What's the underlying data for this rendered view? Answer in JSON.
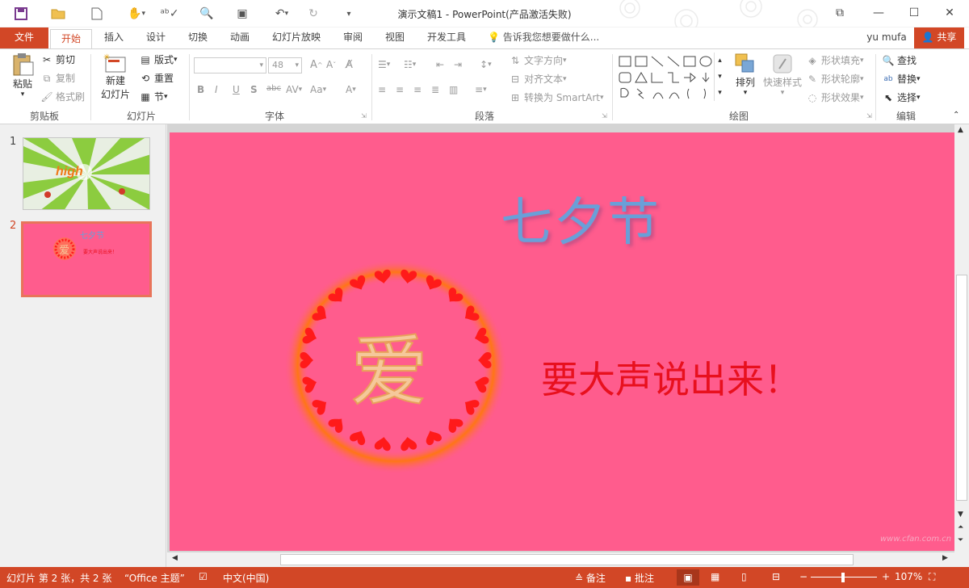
{
  "window": {
    "title": "演示文稿1 - PowerPoint(产品激活失败)",
    "accent": "#d24726"
  },
  "quick_access": [
    "save-icon",
    "open-icon",
    "new-icon",
    "touch-mode-icon",
    "spelling-icon",
    "print-preview-icon",
    "present-icon",
    "undo-icon",
    "redo-icon",
    "customize-icon"
  ],
  "menu": {
    "file": "文件",
    "tabs": [
      "开始",
      "插入",
      "设计",
      "切换",
      "动画",
      "幻灯片放映",
      "审阅",
      "视图",
      "开发工具"
    ],
    "tell_me": "告诉我您想要做什么...",
    "user": "yu mufa",
    "share": "共享"
  },
  "ribbon": {
    "clipboard": {
      "paste": "粘贴",
      "cut": "剪切",
      "copy": "复制",
      "format_painter": "格式刷",
      "label": "剪贴板"
    },
    "slides": {
      "new_slide_1": "新建",
      "new_slide_2": "幻灯片",
      "layout": "版式",
      "reset": "重置",
      "section": "节",
      "label": "幻灯片"
    },
    "font": {
      "size": "48",
      "label": "字体"
    },
    "paragraph": {
      "text_direction": "文字方向",
      "align_text": "对齐文本",
      "convert_smartart": "转换为 SmartArt",
      "label": "段落"
    },
    "drawing": {
      "arrange": "排列",
      "quick_styles": "快速样式",
      "shape_fill": "形状填充",
      "shape_outline": "形状轮廓",
      "shape_effects": "形状效果",
      "label": "绘图"
    },
    "editing": {
      "find": "查找",
      "replace": "替换",
      "select": "选择",
      "label": "编辑"
    }
  },
  "thumbnails": [
    {
      "number": "1",
      "text": "high"
    },
    {
      "number": "2",
      "title": "七夕节",
      "subtitle": "要大声说出来！",
      "center": "爱"
    }
  ],
  "slide": {
    "title": "七夕节",
    "center_char": "爱",
    "subtitle": "要大声说出来！",
    "background": "#ff5c8d",
    "title_color": "#6a9fd8",
    "subtitle_color": "#e8101e",
    "heart_color": "#ff1a1a"
  },
  "status": {
    "slide_info": "幻灯片 第 2 张，共 2 张",
    "theme": "“Office 主题”",
    "language": "中文(中国)",
    "notes": "备注",
    "comments": "批注",
    "zoom": "107%"
  }
}
